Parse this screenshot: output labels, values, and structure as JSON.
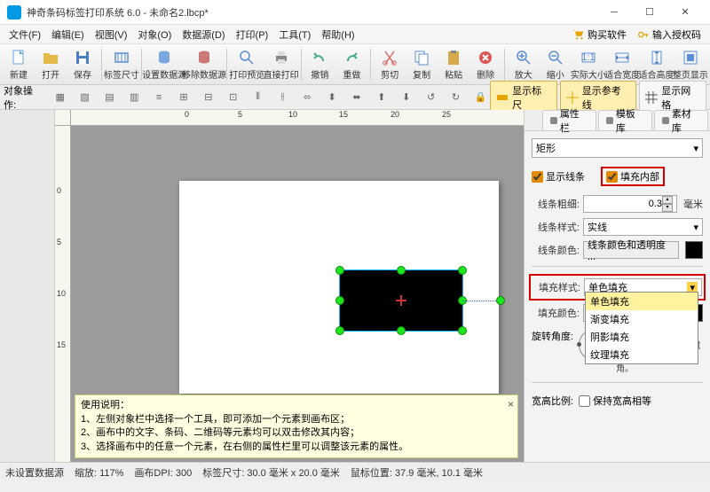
{
  "title": "神奇条码标签打印系统 6.0 - 未命名2.lbcp*",
  "menu": [
    "文件(F)",
    "编辑(E)",
    "视图(V)",
    "对象(O)",
    "数据源(D)",
    "打印(P)",
    "工具(T)",
    "帮助(H)"
  ],
  "menu_right": {
    "buy": "购买软件",
    "auth": "输入授权码"
  },
  "toolbar": [
    "新建",
    "打开",
    "保存",
    "标签尺寸",
    "设置数据源",
    "移除数据源",
    "打印预览",
    "直接打印",
    "撤销",
    "重做",
    "剪切",
    "复制",
    "粘贴",
    "删除",
    "放大",
    "缩小",
    "实际大小",
    "适合宽度",
    "适合高度",
    "整页显示"
  ],
  "objops_label": "对象操作:",
  "toggles": {
    "ruler": "显示标尺",
    "guides": "显示参考线",
    "grid": "显示网格"
  },
  "tabs": {
    "prop": "属性栏",
    "tmpl": "模板库",
    "mat": "素材库"
  },
  "shape_name": "矩形",
  "chk": {
    "stroke": "显示线条",
    "fill": "填充内部"
  },
  "props": {
    "line_weight_label": "线条粗细:",
    "line_weight_value": "0.3",
    "unit": "毫米",
    "line_style_label": "线条样式:",
    "line_style_value": "实线",
    "line_color_label": "线条颜色:",
    "line_color_btn": "线条颜色和透明度 ...",
    "fill_style_label": "填充样式:",
    "fill_style_value": "单色填充",
    "fill_options": [
      "单色填充",
      "渐变填充",
      "阴影填充",
      "纹理填充"
    ],
    "fill_color_label": "填充颜色:",
    "rotate_label": "旋转角度:",
    "rotate_desc": "说明：在左侧小圆点上按住 Shift 键拖动鼠标可以生成15度倍数角。",
    "ratio_label": "宽高比例:",
    "ratio_chk": "保持宽高相等"
  },
  "hint": {
    "title": "使用说明：",
    "l1": "1、左侧对象栏中选择一个工具，即可添加一个元素到画布区；",
    "l2": "2、画布中的文字、条码、二维码等元素均可以双击修改其内容；",
    "l3": "3、选择画布中的任意一个元素，在右侧的属性栏里可以调整该元素的属性。"
  },
  "status": {
    "ds": "未设置数据源",
    "zoom": "缩放: 117%",
    "dpi": "画布DPI:  300",
    "size": "标签尺寸:  30.0 毫米 x 20.0 毫米",
    "mouse": "鼠标位置:  37.9 毫米,  10.1 毫米"
  },
  "ruler_h": [
    "0",
    "5",
    "10",
    "15",
    "20",
    "25"
  ],
  "ruler_v": [
    "0",
    "5",
    "10",
    "15"
  ]
}
